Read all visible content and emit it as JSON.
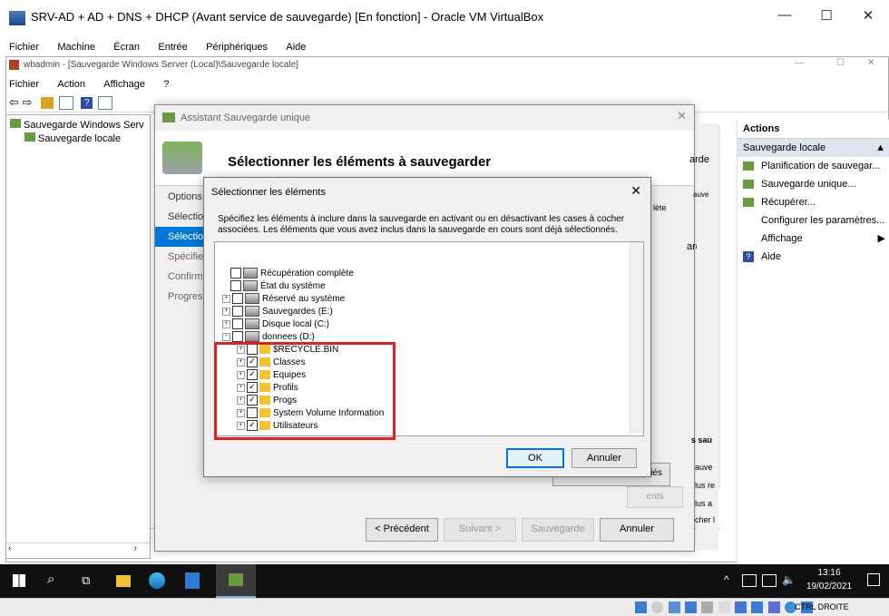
{
  "vbox": {
    "title": "SRV-AD + AD + DNS + DHCP (Avant service de sauvegarde) [En fonction] - Oracle VM VirtualBox",
    "menu": [
      "Fichier",
      "Machine",
      "Écran",
      "Entrée",
      "Périphériques",
      "Aide"
    ],
    "min": "—",
    "max": "☐",
    "close": "✕",
    "host_key": "CTRL DROITE"
  },
  "mmc": {
    "title": "wbadmin - [Sauvegarde Windows Server (Local)\\Sauvegarde locale]",
    "menu": [
      "Fichier",
      "Action",
      "Affichage",
      "?"
    ],
    "tree": [
      "Sauvegarde Windows Serv",
      "Sauvegarde locale"
    ]
  },
  "actions": {
    "header": "Actions",
    "section": "Sauvegarde locale",
    "items": [
      "Planification de sauvegar...",
      "Sauvegarde unique...",
      "Récupérer...",
      "Configurer les paramètres...",
      "Affichage",
      "Aide"
    ]
  },
  "wizard": {
    "title": "Assistant Sauvegarde unique",
    "heading": "Sélectionner les éléments à sauvegarder",
    "steps": [
      "Options",
      "Sélection",
      "Sélection",
      "Spécifier",
      "Confirm",
      "Progress"
    ],
    "buttons": {
      "prev": "< Précédent",
      "next": "Suivant >",
      "backup": "Sauvegarde",
      "cancel": "Annuler"
    },
    "right_frags": [
      "arde",
      "auve",
      "lète",
      "s sau",
      "auve",
      "lus re",
      "lus a",
      "cher l",
      "ents",
      "iés"
    ]
  },
  "dialog": {
    "title": "Sélectionner les éléments",
    "close": "✕",
    "desc": "Spécifiez les éléments à inclure dans la sauvegarde en activant ou en désactivant les cases à cocher associées. Les éléments que vous avez inclus dans la sauvegarde en cours sont déjà sélectionnés.",
    "ok": "OK",
    "cancel": "Annuler",
    "tree": [
      {
        "label": "Récupération complète",
        "checked": false,
        "expander": false
      },
      {
        "label": "État du système",
        "checked": false,
        "expander": false
      },
      {
        "label": "Réservé au système",
        "checked": false,
        "expander": true
      },
      {
        "label": "Sauvegardes (E:)",
        "checked": false,
        "expander": true
      },
      {
        "label": "Disque local (C:)",
        "checked": false,
        "expander": true
      },
      {
        "label": "donnees (D:)",
        "checked": false,
        "expander": true
      },
      {
        "label": "$RECYCLE.BIN",
        "checked": false,
        "expander": true
      },
      {
        "label": "Classes",
        "checked": true,
        "expander": true
      },
      {
        "label": "Equipes",
        "checked": true,
        "expander": true
      },
      {
        "label": "Profils",
        "checked": true,
        "expander": true
      },
      {
        "label": "Progs",
        "checked": true,
        "expander": true
      },
      {
        "label": "System Volume Information",
        "checked": false,
        "expander": true
      },
      {
        "label": "Utilisateurs",
        "checked": true,
        "expander": true
      }
    ]
  },
  "tray": {
    "time": "13:16",
    "date": "19/02/2021"
  }
}
